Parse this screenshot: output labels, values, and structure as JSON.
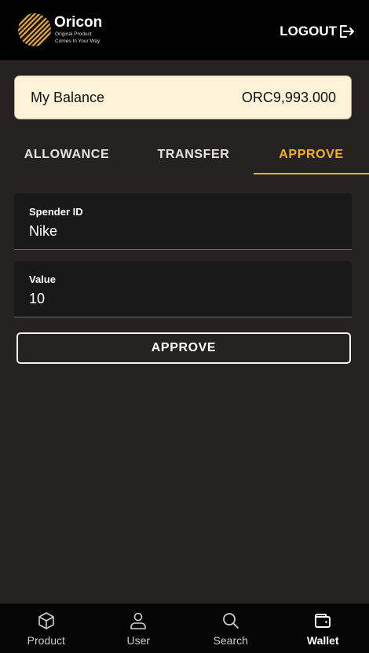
{
  "header": {
    "brand_name": "Oricon",
    "tagline_1": "Original Product",
    "tagline_2": "Comes In Your Way",
    "logout_label": "LOGOUT"
  },
  "balance": {
    "label": "My Balance",
    "value": "ORC9,993.000"
  },
  "tabs": [
    {
      "label": "ALLOWANCE",
      "active": false
    },
    {
      "label": "TRANSFER",
      "active": false
    },
    {
      "label": "APPROVE",
      "active": true
    }
  ],
  "form": {
    "spender_label": "Spender ID",
    "spender_value": "Nike",
    "value_label": "Value",
    "value_value": "10",
    "submit_label": "APPROVE"
  },
  "nav": {
    "items": [
      {
        "label": "Product",
        "icon": "cube-icon",
        "active": false
      },
      {
        "label": "User",
        "icon": "user-icon",
        "active": false
      },
      {
        "label": "Search",
        "icon": "search-icon",
        "active": false
      },
      {
        "label": "Wallet",
        "icon": "wallet-icon",
        "active": true
      }
    ]
  },
  "colors": {
    "accent": "#f3b31b",
    "background": "#272222",
    "header": "#020202",
    "balance_card": "#fff4d9"
  }
}
